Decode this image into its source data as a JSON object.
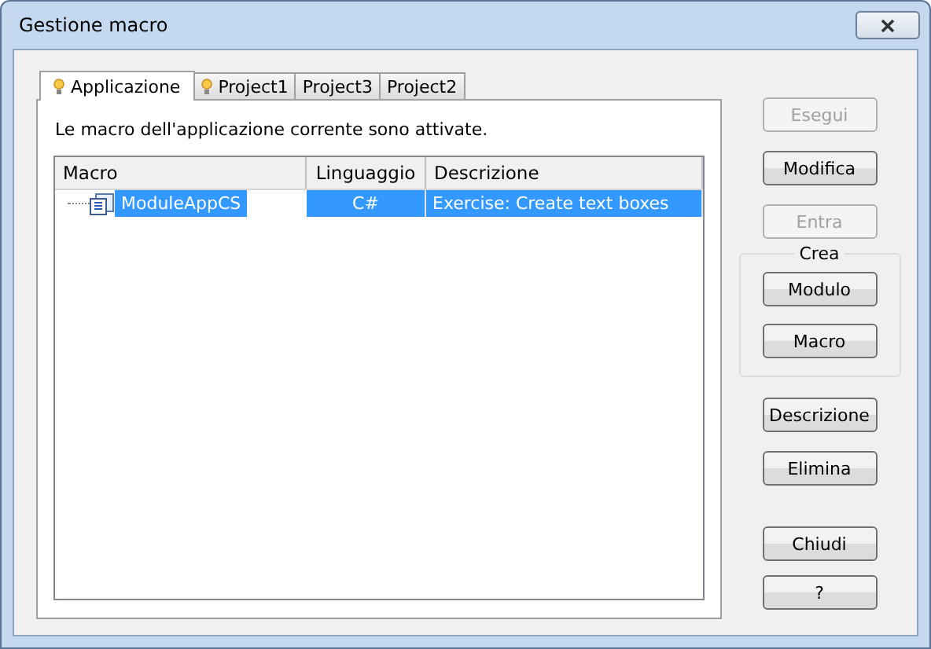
{
  "window": {
    "title": "Gestione macro"
  },
  "tabs": [
    {
      "label": "Applicazione",
      "selected": true,
      "icon": true
    },
    {
      "label": "Project1",
      "selected": false,
      "icon": true
    },
    {
      "label": "Project3",
      "selected": false,
      "icon": false
    },
    {
      "label": "Project2",
      "selected": false,
      "icon": false
    }
  ],
  "status_text": "Le macro dell'applicazione corrente sono attivate.",
  "table": {
    "columns": [
      "Macro",
      "Linguaggio",
      "Descrizione"
    ],
    "rows": [
      {
        "cells": [
          "ModuleAppCS",
          "C#",
          "Exercise: Create text boxes"
        ],
        "selected": true
      }
    ]
  },
  "buttons_top": [
    {
      "label": "Esegui",
      "disabled": true
    },
    {
      "label": "Modifica",
      "disabled": false
    },
    {
      "label": "Entra",
      "disabled": true
    }
  ],
  "create_group": {
    "title": "Crea",
    "buttons": [
      {
        "label": "Modulo",
        "disabled": false
      },
      {
        "label": "Macro",
        "disabled": false
      }
    ]
  },
  "buttons_middle": [
    {
      "label": "Descrizione",
      "disabled": false
    },
    {
      "label": "Elimina",
      "disabled": false
    }
  ],
  "buttons_bottom": [
    {
      "label": "Chiudi",
      "disabled": false
    },
    {
      "label": "?",
      "disabled": false
    }
  ]
}
